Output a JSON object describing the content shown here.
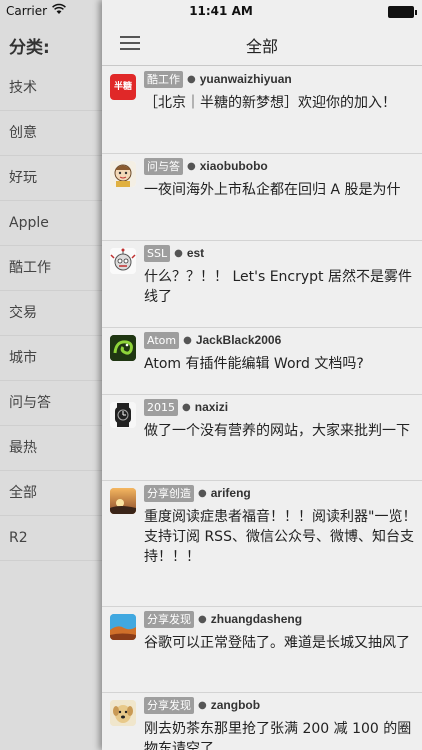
{
  "status_bar": {
    "carrier": "Carrier",
    "time": "11:41 AM"
  },
  "sidebar": {
    "title": "分类:",
    "items": [
      {
        "label": "技术"
      },
      {
        "label": "创意"
      },
      {
        "label": "好玩"
      },
      {
        "label": "Apple"
      },
      {
        "label": "酷工作"
      },
      {
        "label": "交易"
      },
      {
        "label": "城市"
      },
      {
        "label": "问与答"
      },
      {
        "label": "最热"
      },
      {
        "label": "全部"
      },
      {
        "label": "R2"
      }
    ]
  },
  "navbar": {
    "title": "全部"
  },
  "topics": [
    {
      "node": "酷工作",
      "user": "yuanwaizhiyuan",
      "title": "［北京｜半糖的新梦想］欢迎你的加入！",
      "avatar_icon": "bantang-logo-icon",
      "avatar_text": "半糖"
    },
    {
      "node": "问与答",
      "user": "xiaobubobo",
      "title": "一夜间海外上市私企都在回归 A 股是为什",
      "avatar_icon": "cartoon-avatar-icon"
    },
    {
      "node": "SSL",
      "user": "est",
      "title": "什么？？！！ Let's Encrypt 居然不是雾件线了",
      "avatar_icon": "robot-avatar-icon"
    },
    {
      "node": "Atom",
      "user": "JackBlack2006",
      "title": "Atom 有插件能编辑 Word 文档吗?",
      "avatar_icon": "chameleon-avatar-icon"
    },
    {
      "node": "2015",
      "user": "naxizi",
      "title": "做了一个没有营养的网站，大家来批判一下",
      "avatar_icon": "watch-avatar-icon"
    },
    {
      "node": "分享创造",
      "user": "arifeng",
      "title": "重度阅读症患者福音！！！阅读利器\"一览！支持订阅 RSS、微信公众号、微博、知台支持！！！",
      "avatar_icon": "sunset-avatar-icon"
    },
    {
      "node": "分享发现",
      "user": "zhuangdasheng",
      "title": "谷歌可以正常登陆了。难道是长城又抽风了",
      "avatar_icon": "landscape-avatar-icon"
    },
    {
      "node": "分享发现",
      "user": "zangbob",
      "title": "刚去奶茶东那里抢了张满 200 减 100 的圈物东请空了",
      "avatar_icon": "dog-avatar-icon"
    }
  ]
}
